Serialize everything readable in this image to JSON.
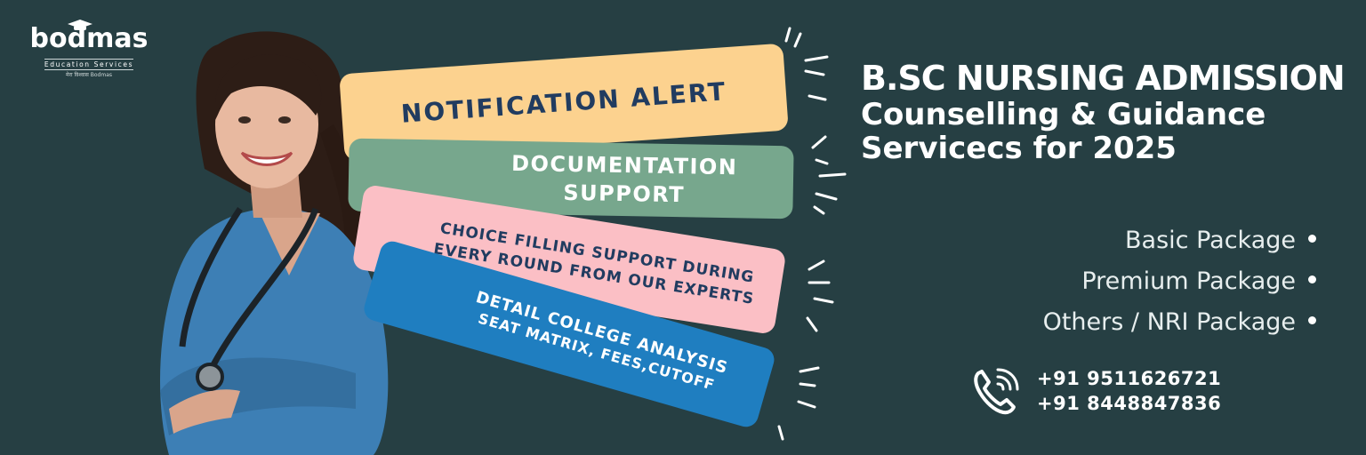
{
  "logo": {
    "word": "bodmas",
    "subtitle": "Education Services",
    "tagline": "मेरा विश्वास Bodmas"
  },
  "banners": [
    {
      "lines": [
        "Notification Alert"
      ]
    },
    {
      "lines": [
        "Documentation",
        "Support"
      ]
    },
    {
      "lines": [
        "Choice Filling Support During",
        "Every Round From Our Experts"
      ]
    },
    {
      "lines": [
        "Detail College Analysis",
        "Seat Matrix, Fees,Cutoff"
      ]
    }
  ],
  "headline": {
    "line1": "B.SC NURSING ADMISSION",
    "line2": "Counselling & Guidance",
    "line3": "Servicecs for 2025"
  },
  "packages": [
    "Basic Package",
    "Premium Package",
    "Others / NRI Package"
  ],
  "contact": {
    "icon": "phone-icon",
    "phones": [
      "+91 9511626721",
      "+91 8448847836"
    ]
  },
  "colors": {
    "background": "#263f43",
    "banner_yellow": "#fcd28f",
    "banner_green": "#77a78d",
    "banner_pink": "#fbbfc5",
    "banner_blue": "#1f7ec0",
    "banner_text": "#213c60"
  }
}
